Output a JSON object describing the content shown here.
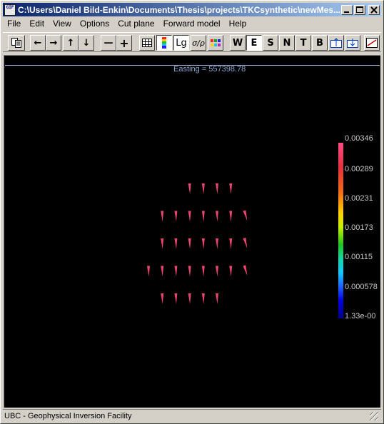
{
  "window": {
    "title": "C:\\Users\\Daniel Bild-Enkin\\Documents\\Thesis\\projects\\TKCsynthetic\\newMes...",
    "icon_text": "GIF",
    "minimize_icon": "minimize-icon",
    "maximize_icon": "maximize-icon",
    "close_icon": "close-icon"
  },
  "menu": [
    "File",
    "Edit",
    "View",
    "Options",
    "Cut plane",
    "Forward model",
    "Help"
  ],
  "toolbar": {
    "copy_icon": "copy-icon",
    "left_arrow": "←",
    "right_arrow": "→",
    "up_arrow": "↑",
    "down_arrow": "↓",
    "minus": "—",
    "plus": "+",
    "grid_icon": "grid-icon",
    "colorscale_icon": "colorscale-icon",
    "lg_label": "Lg",
    "sigma_rho_label": "σ∕ρ",
    "palette_icon": "palette-icon",
    "dir_W": "W",
    "dir_E": "E",
    "dir_S": "S",
    "dir_N": "N",
    "dir_T": "T",
    "dir_B": "B",
    "export_icon": "export-icon",
    "import_icon": "import-icon",
    "plot_icon": "plot-icon"
  },
  "view": {
    "easting_label": "Easting =  557398.78",
    "colorbar_labels": [
      "0.00346",
      "0.00289",
      "0.00231",
      "0.00173",
      "0.00115",
      "0.000578",
      "1.33e-00"
    ],
    "arrow_color": "#e8446e",
    "arrows": [
      {
        "col": 3,
        "row": 0,
        "dir": "down"
      },
      {
        "col": 4,
        "row": 0,
        "dir": "down"
      },
      {
        "col": 5,
        "row": 0,
        "dir": "down"
      },
      {
        "col": 6,
        "row": 0,
        "dir": "down"
      },
      {
        "col": 1,
        "row": 1,
        "dir": "down"
      },
      {
        "col": 2,
        "row": 1,
        "dir": "down"
      },
      {
        "col": 3,
        "row": 1,
        "dir": "down"
      },
      {
        "col": 4,
        "row": 1,
        "dir": "down"
      },
      {
        "col": 5,
        "row": 1,
        "dir": "down"
      },
      {
        "col": 6,
        "row": 1,
        "dir": "down"
      },
      {
        "col": 7,
        "row": 1,
        "dir": "slant"
      },
      {
        "col": 1,
        "row": 2,
        "dir": "down"
      },
      {
        "col": 2,
        "row": 2,
        "dir": "down"
      },
      {
        "col": 3,
        "row": 2,
        "dir": "down"
      },
      {
        "col": 4,
        "row": 2,
        "dir": "down"
      },
      {
        "col": 5,
        "row": 2,
        "dir": "down"
      },
      {
        "col": 6,
        "row": 2,
        "dir": "down"
      },
      {
        "col": 7,
        "row": 2,
        "dir": "slant"
      },
      {
        "col": 0,
        "row": 3,
        "dir": "down"
      },
      {
        "col": 1,
        "row": 3,
        "dir": "down"
      },
      {
        "col": 2,
        "row": 3,
        "dir": "down"
      },
      {
        "col": 3,
        "row": 3,
        "dir": "down"
      },
      {
        "col": 4,
        "row": 3,
        "dir": "down"
      },
      {
        "col": 5,
        "row": 3,
        "dir": "down"
      },
      {
        "col": 6,
        "row": 3,
        "dir": "down"
      },
      {
        "col": 7,
        "row": 3,
        "dir": "slant"
      },
      {
        "col": 1,
        "row": 4,
        "dir": "down"
      },
      {
        "col": 2,
        "row": 4,
        "dir": "down"
      },
      {
        "col": 3,
        "row": 4,
        "dir": "down"
      },
      {
        "col": 4,
        "row": 4,
        "dir": "down"
      },
      {
        "col": 5,
        "row": 4,
        "dir": "down"
      }
    ]
  },
  "status": {
    "text": "UBC - Geophysical Inversion Facility"
  }
}
